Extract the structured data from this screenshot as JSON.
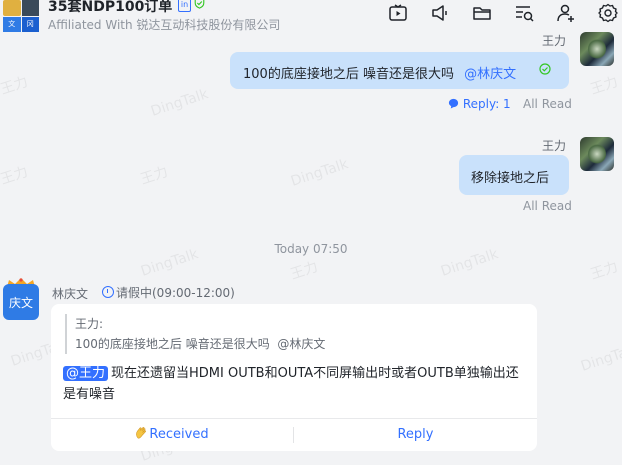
{
  "header": {
    "title": "35套NDP100订单",
    "badge": "in",
    "subtitle": "Affiliated With 锐达互动科技股份有限公司",
    "avatar_cells": [
      "文",
      "冈"
    ],
    "toolbar_icons": [
      "video-icon",
      "megaphone-icon",
      "folder-icon",
      "search-list-icon",
      "add-member-icon",
      "settings-icon"
    ]
  },
  "watermark": "DingTalk",
  "watermark_name": "王力",
  "messages": [
    {
      "sender": "王力",
      "text": "100的底座接地之后 噪音还是很大吗",
      "mention": "@林庆文",
      "reply_label": "Reply: 1",
      "read_status": "All Read"
    },
    {
      "sender": "王力",
      "text": "移除接地之后",
      "read_status": "All Read"
    }
  ],
  "time_divider": "Today 07:50",
  "incoming": {
    "avatar_label": "庆文",
    "sender": "林庆文",
    "status": "请假中(09:00-12:00)",
    "quote_author": "王力:",
    "quote_text": "100的底座接地之后 噪音还是很大吗  @林庆文",
    "mention": "@王力",
    "text": "现在还遗留当HDMI OUTB和OUTA不同屏输出时或者OUTB单独输出还是有噪音",
    "received_label": "Received",
    "reply_label": "Reply"
  },
  "colors": {
    "accent": "#3370ff",
    "my_bubble": "#c9e1fb",
    "background": "#f2f3f5",
    "read_check": "#34c724"
  }
}
